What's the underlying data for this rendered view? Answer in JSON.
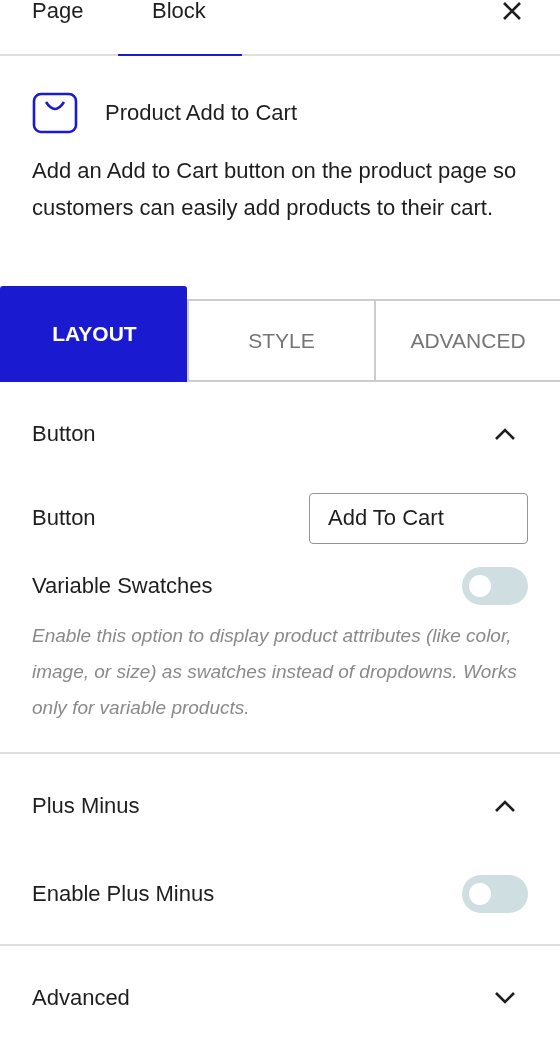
{
  "top_tabs": [
    {
      "label": "Page",
      "selected": false
    },
    {
      "label": "Block",
      "selected": true
    }
  ],
  "block": {
    "title": "Product Add to Cart",
    "description": "Add an Add to Cart button on the product page so customers can easily add products to their cart."
  },
  "settings_tabs": [
    {
      "label": "LAYOUT",
      "selected": true
    },
    {
      "label": "STYLE",
      "selected": false
    },
    {
      "label": "ADVANCED",
      "selected": false
    }
  ],
  "sections": [
    {
      "title": "Button",
      "expanded": true,
      "rows": [
        {
          "kind": "text",
          "label": "Button",
          "value": "Add To Cart"
        },
        {
          "kind": "toggle",
          "label": "Variable Swatches",
          "on": false,
          "help": "Enable this option to display product attributes (like color, image, or size) as swatches instead of dropdowns. Works only for variable products."
        }
      ]
    },
    {
      "title": "Plus Minus",
      "expanded": true,
      "rows": [
        {
          "kind": "toggle",
          "label": "Enable Plus Minus",
          "on": false
        }
      ]
    },
    {
      "title": "Advanced",
      "expanded": false
    }
  ]
}
